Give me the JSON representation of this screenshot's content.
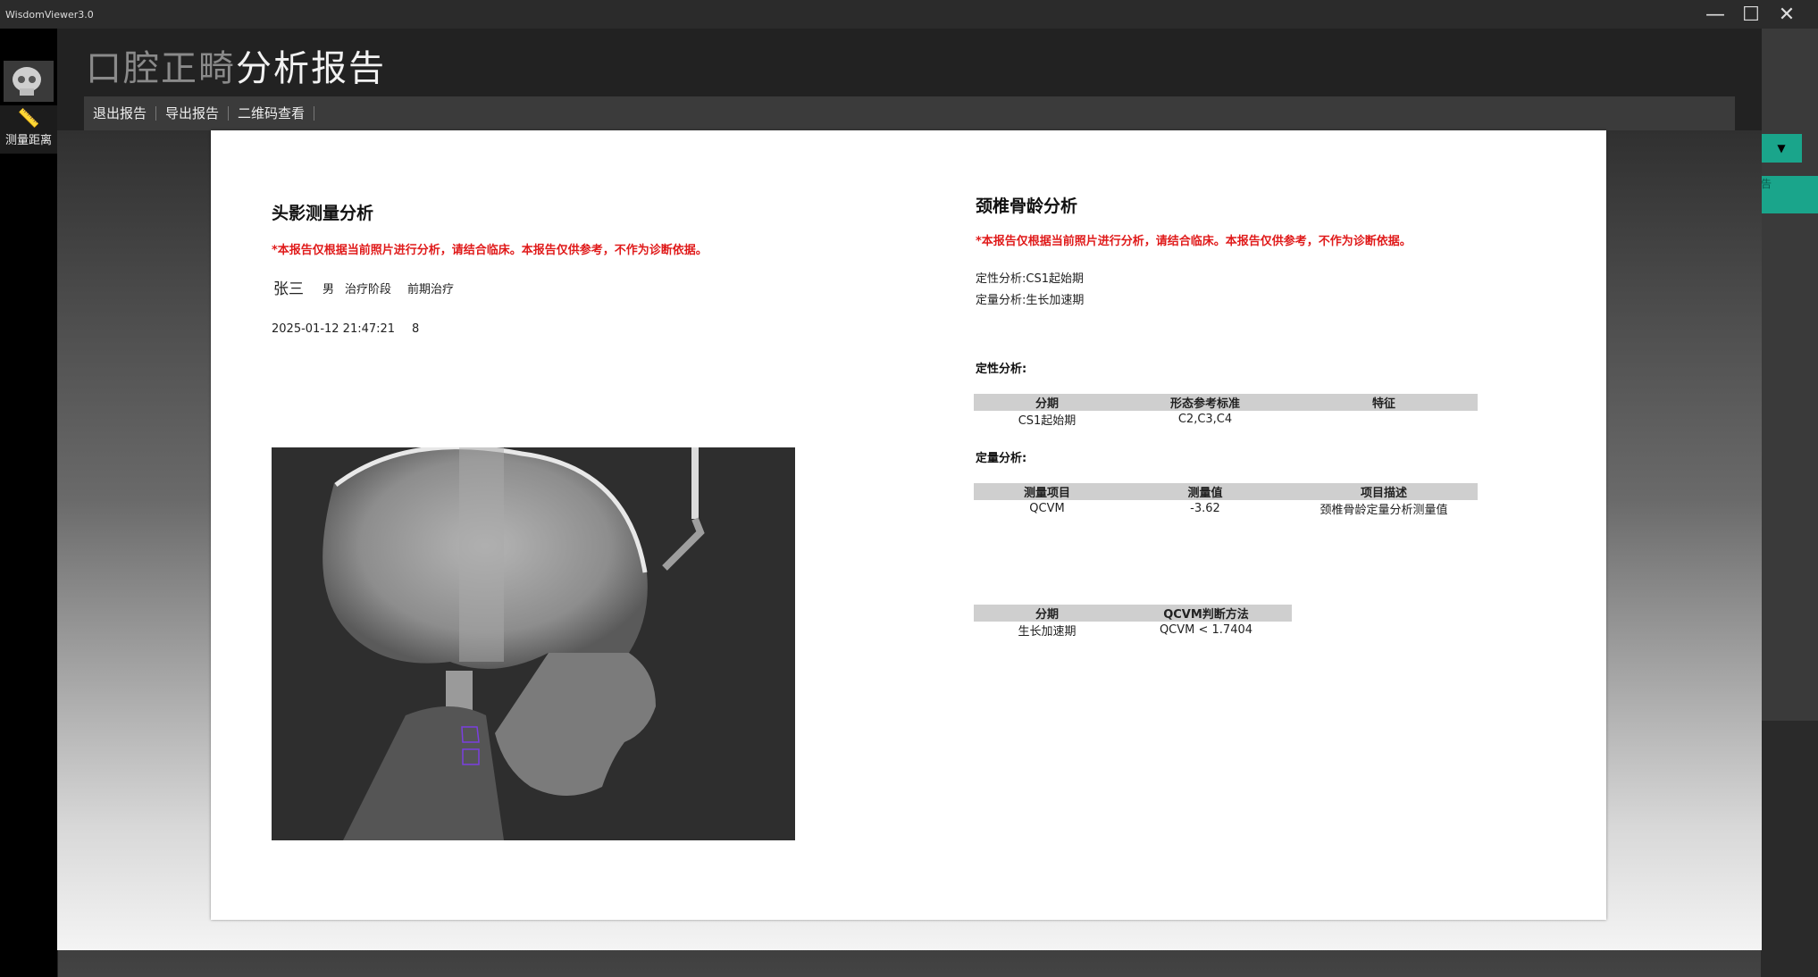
{
  "app": {
    "title": "WisdomViewer3.0"
  },
  "window_controls": {
    "minimize": "—",
    "maximize": "☐",
    "close": "✕"
  },
  "rail": {
    "tool_label": "测量距离"
  },
  "right_panel": {
    "dropdown_arrow": "▼",
    "tab_fragment": "告"
  },
  "modal": {
    "title_main": "口腔正畸",
    "title_sub": "分析报告",
    "toolbar": [
      "退出报告",
      "导出报告",
      "二维码查看"
    ]
  },
  "report": {
    "left": {
      "heading": "头影测量分析",
      "disclaimer": "*本报告仅根据当前照片进行分析，请结合临床。本报告仅供参考，不作为诊断依据。",
      "patient_name": "张三",
      "gender": "男",
      "stage_label": "治疗阶段",
      "stage_value": "前期治疗",
      "datetime": "2025-01-12 21:47:21",
      "count": "8"
    },
    "right": {
      "heading": "颈椎骨龄分析",
      "disclaimer": "*本报告仅根据当前照片进行分析，请结合临床。本报告仅供参考，不作为诊断依据。",
      "qual_summary": "定性分析:CS1起始期",
      "quant_summary": "定量分析:生长加速期",
      "qual_title": "定性分析:",
      "qual_table": {
        "headers": [
          "分期",
          "形态参考标准",
          "特征"
        ],
        "rows": [
          [
            "CS1起始期",
            "C2,C3,C4",
            ""
          ]
        ]
      },
      "quant_title": "定量分析:",
      "quant_table": {
        "headers": [
          "测量项目",
          "测量值",
          "项目描述"
        ],
        "rows": [
          [
            "QCVM",
            "-3.62",
            "颈椎骨龄定量分析测量值"
          ]
        ]
      },
      "method_table": {
        "headers": [
          "分期",
          "QCVM判断方法"
        ],
        "rows": [
          [
            "生长加速期",
            "QCVM < 1.7404"
          ]
        ]
      }
    }
  }
}
